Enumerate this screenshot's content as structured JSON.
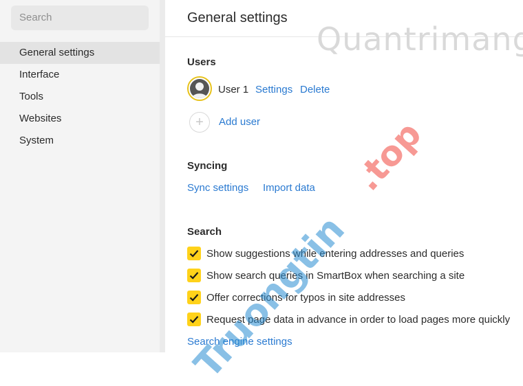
{
  "sidebar": {
    "search_placeholder": "Search",
    "items": [
      {
        "label": "General settings",
        "active": true
      },
      {
        "label": "Interface"
      },
      {
        "label": "Tools"
      },
      {
        "label": "Websites"
      },
      {
        "label": "System"
      }
    ]
  },
  "main": {
    "title": "General settings",
    "users": {
      "heading": "Users",
      "user_name": "User 1",
      "settings_link": "Settings",
      "delete_link": "Delete",
      "add_user_link": "Add user"
    },
    "syncing": {
      "heading": "Syncing",
      "sync_settings_link": "Sync settings",
      "import_data_link": "Import data"
    },
    "search": {
      "heading": "Search",
      "options": [
        {
          "label": "Show suggestions while entering addresses and queries",
          "checked": true
        },
        {
          "label": "Show search queries in SmartBox when searching a site",
          "checked": true
        },
        {
          "label": "Offer corrections for typos in site addresses",
          "checked": true
        },
        {
          "label": "Request page data in advance in order to load pages more quickly",
          "checked": true
        }
      ],
      "engine_settings_link": "Search engine settings"
    }
  },
  "watermarks": {
    "top": "Quantrimang",
    "diagonal_blue": "Truongtin",
    "diagonal_red": ".top"
  },
  "colors": {
    "accent_link": "#2a7ad1",
    "checkbox": "#ffd21a",
    "avatar_ring": "#e7c21b",
    "sidebar_bg": "#f4f4f4"
  }
}
